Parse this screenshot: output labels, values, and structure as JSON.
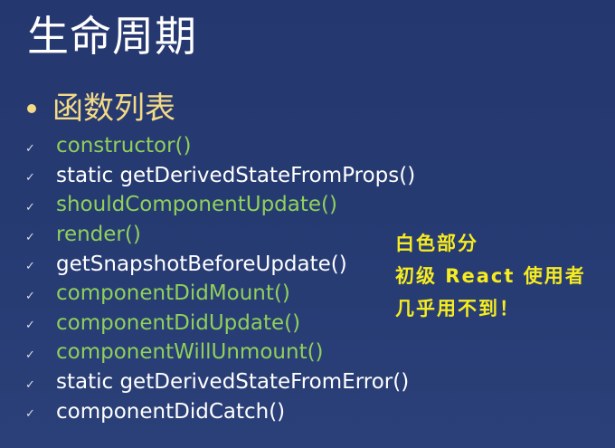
{
  "title": "生命周期",
  "subhead": "函数列表",
  "items": [
    {
      "text": "constructor()",
      "green": true
    },
    {
      "text": "static getDerivedStateFromProps()",
      "green": false
    },
    {
      "text": "shouldComponentUpdate()",
      "green": true
    },
    {
      "text": "render()",
      "green": true
    },
    {
      "text": "getSnapshotBeforeUpdate()",
      "green": false
    },
    {
      "text": "componentDidMount()",
      "green": true
    },
    {
      "text": "componentDidUpdate()",
      "green": true
    },
    {
      "text": "componentWillUnmount()",
      "green": true
    },
    {
      "text": "static getDerivedStateFromError()",
      "green": false
    },
    {
      "text": "componentDidCatch()",
      "green": false
    }
  ],
  "check_glyph": "✓",
  "note": {
    "line1": "白色部分",
    "line2": "初级 React 使用者",
    "line3": "几乎用不到！"
  },
  "colors": {
    "green": "#8fd15b",
    "white": "#ffffff",
    "subhead": "#f3da86",
    "note": "#f6ec1f",
    "background": "#263a72"
  }
}
